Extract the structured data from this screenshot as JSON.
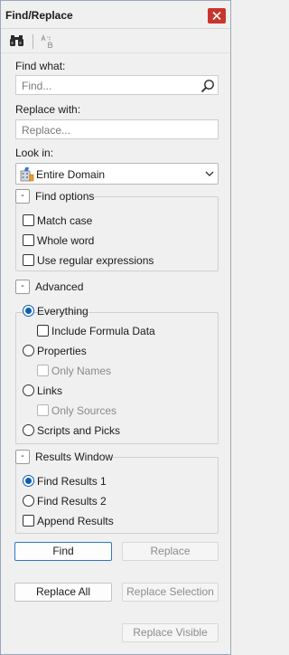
{
  "window": {
    "title": "Find/Replace"
  },
  "icons": {
    "close": "close-icon",
    "find_mode": "binoculars-icon",
    "replace_mode": "replace-icon",
    "search": "search-icon",
    "scope": "domain-icon",
    "dropdown": "chevron-down-icon"
  },
  "colors": {
    "accent": "#0a5fb4",
    "close_bg": "#c8352f",
    "default_button_border": "#2b78c8"
  },
  "find": {
    "label": "Find what:",
    "placeholder": "Find...",
    "value": ""
  },
  "replace": {
    "label": "Replace with:",
    "placeholder": "Replace...",
    "value": ""
  },
  "look_in": {
    "label": "Look in:",
    "selected": "Entire Domain"
  },
  "find_options": {
    "title": "Find options",
    "collapse_label": "-",
    "match_case": {
      "label": "Match case",
      "checked": false
    },
    "whole_word": {
      "label": "Whole word",
      "checked": false
    },
    "regex": {
      "label": "Use regular expressions",
      "checked": false
    }
  },
  "advanced": {
    "title": "Advanced",
    "collapse_label": "-",
    "everything": {
      "label": "Everything",
      "selected": true
    },
    "include_formula": {
      "label": "Include Formula Data",
      "checked": false
    },
    "properties": {
      "label": "Properties",
      "selected": false
    },
    "only_names": {
      "label": "Only Names",
      "checked": false,
      "enabled": false
    },
    "links": {
      "label": "Links",
      "selected": false
    },
    "only_sources": {
      "label": "Only Sources",
      "checked": false,
      "enabled": false
    },
    "scripts": {
      "label": "Scripts and Picks",
      "selected": false
    }
  },
  "results_window": {
    "title": "Results Window",
    "collapse_label": "-",
    "find_results_1": {
      "label": "Find Results 1",
      "selected": true
    },
    "find_results_2": {
      "label": "Find Results 2",
      "selected": false
    },
    "append": {
      "label": "Append Results",
      "checked": false
    }
  },
  "buttons": {
    "find": "Find",
    "replace": "Replace",
    "replace_all": "Replace All",
    "replace_selection": "Replace Selection",
    "replace_visible": "Replace Visible"
  }
}
